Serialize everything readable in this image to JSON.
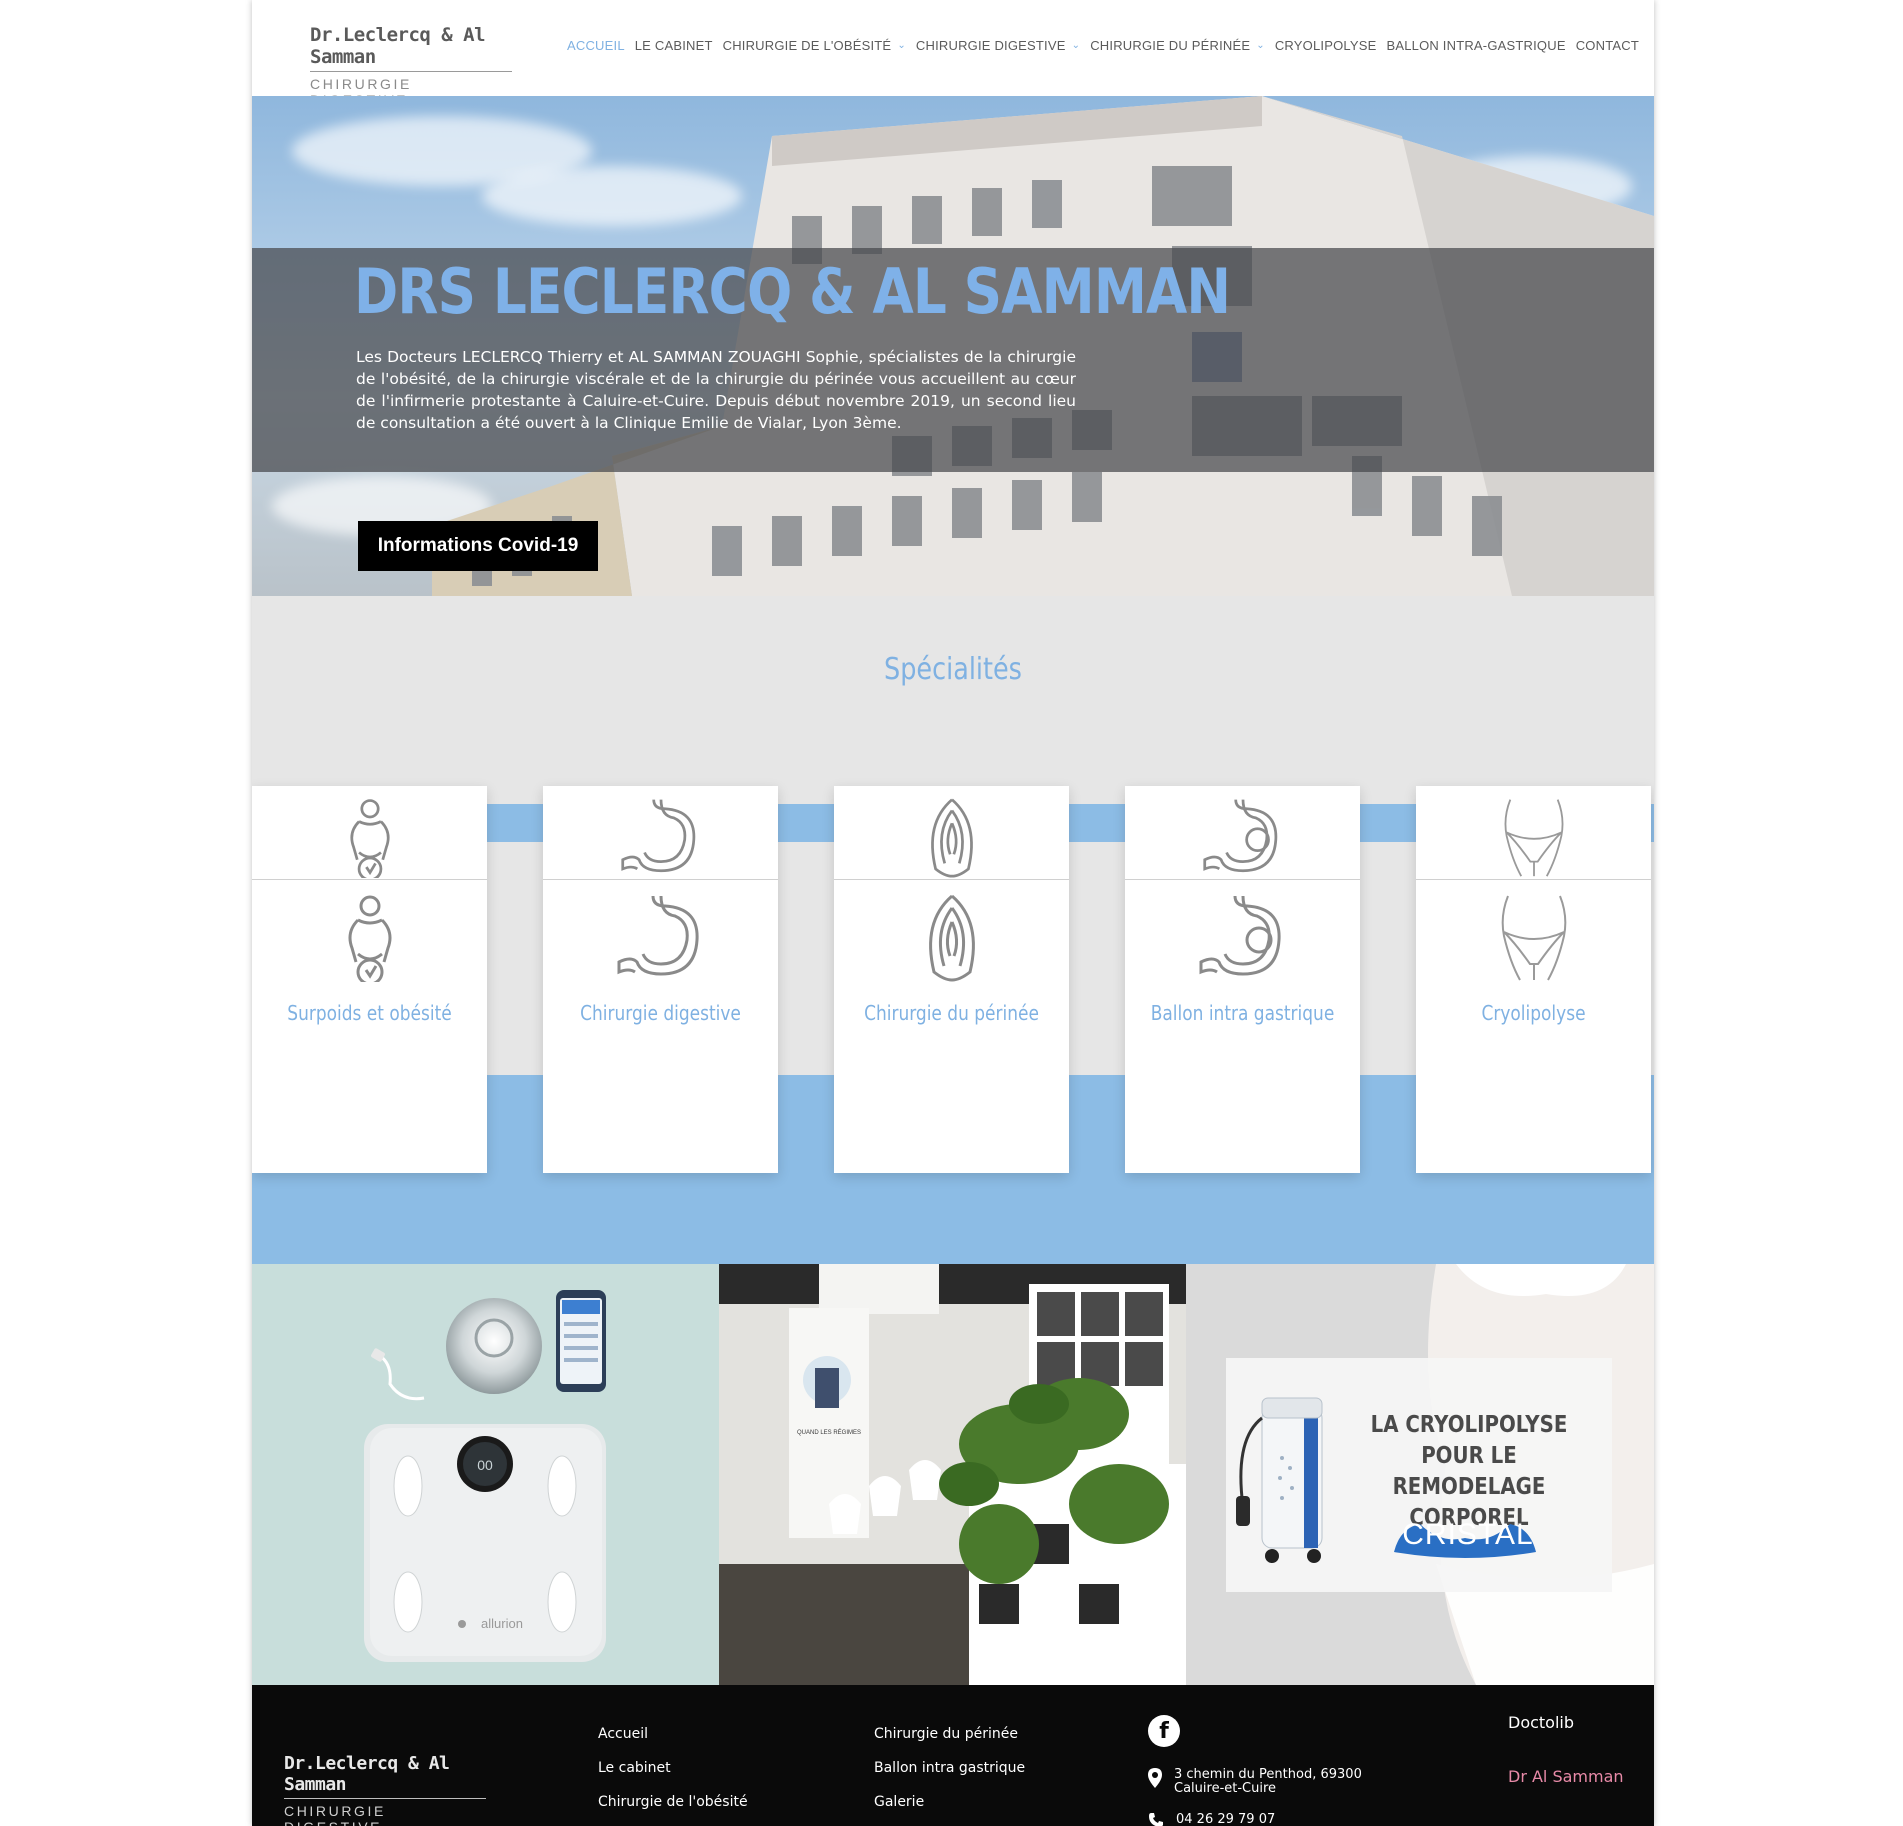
{
  "header": {
    "logo_line1": "Dr.Leclercq & Al Samman",
    "logo_line2": "CHIRURGIE DIGESTIVE",
    "nav": [
      {
        "label": "ACCUEIL",
        "active": true,
        "dropdown": false
      },
      {
        "label": "LE CABINET",
        "active": false,
        "dropdown": false
      },
      {
        "label": "CHIRURGIE DE L'OBÉSITÉ",
        "active": false,
        "dropdown": true
      },
      {
        "label": "CHIRURGIE DIGESTIVE",
        "active": false,
        "dropdown": true
      },
      {
        "label": "CHIRURGIE DU PÉRINÉE",
        "active": false,
        "dropdown": true
      },
      {
        "label": "CRYOLIPOLYSE",
        "active": false,
        "dropdown": false
      },
      {
        "label": "BALLON INTRA-GASTRIQUE",
        "active": false,
        "dropdown": false
      },
      {
        "label": "CONTACT",
        "active": false,
        "dropdown": false
      }
    ]
  },
  "hero": {
    "title": "DRS LECLERCQ & AL SAMMAN",
    "text": "Les Docteurs LECLERCQ Thierry et AL SAMMAN ZOUAGHI Sophie, spécialistes de la chirurgie de l'obésité, de la chirurgie viscérale et de la chirurgie du périnée vous accueillent au cœur de l'infirmerie protestante à Caluire-et-Cuire. Depuis début novembre 2019, un second lieu de consultation a été ouvert à la Clinique Emilie de Vialar, Lyon 3ème.",
    "button": "Informations Covid-19"
  },
  "specialites": {
    "title": "Spécialités",
    "cards": [
      {
        "label": "Surpoids et obésité",
        "icon": "scale-person-icon"
      },
      {
        "label": "Chirurgie digestive",
        "icon": "stomach-icon"
      },
      {
        "label": "Chirurgie du périnée",
        "icon": "perineum-icon"
      },
      {
        "label": "Ballon intra gastrique",
        "icon": "stomach-balloon-icon"
      },
      {
        "label": "Cryolipolyse",
        "icon": "body-contour-icon"
      }
    ]
  },
  "photos": {
    "p1_brand": "allurion",
    "p1_scale_display": "00",
    "p2_poster": "QUAND LES RÉGIMES ET L'EXERCICE NE SUFFISENT PAS",
    "p3_title_lines": [
      "LA CRYOLIPOLYSE",
      "POUR LE REMODELAGE",
      "CORPOREL"
    ],
    "p3_brand": "CRISTAL"
  },
  "footer": {
    "logo_line1": "Dr.Leclercq & Al Samman",
    "logo_line2": "CHIRURGIE DIGESTIVE",
    "col1": [
      "Accueil",
      "Le cabinet",
      "Chirurgie de l'obésité"
    ],
    "col2": [
      "Chirurgie du périnée",
      "Ballon intra gastrique",
      "Galerie"
    ],
    "facebook": "f",
    "address": "3 chemin du Penthod, 69300 Caluire-et-Cuire",
    "phone": "04 26 29 79 07",
    "doctolib_label": "Doctolib",
    "doctolib_link": "Dr Al Samman"
  },
  "colors": {
    "accent": "#7fb1e2",
    "stripe": "#8cbce5",
    "footer_bg": "#0a0a0a",
    "link_pink": "#e88aa8"
  }
}
